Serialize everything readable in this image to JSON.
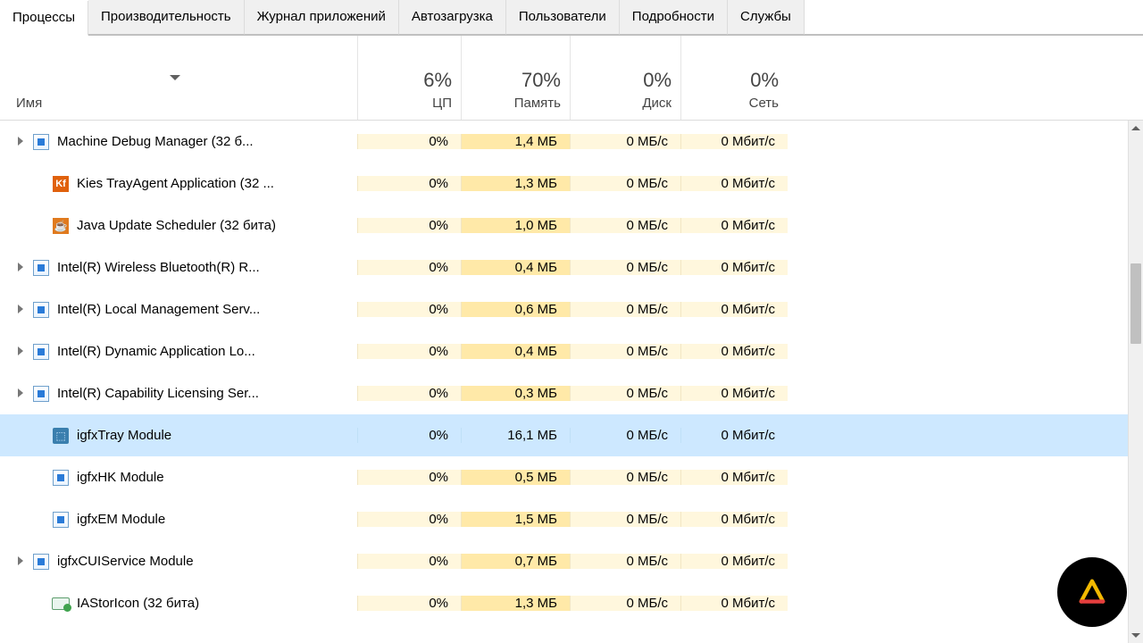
{
  "tabs": [
    "Процессы",
    "Производительность",
    "Журнал приложений",
    "Автозагрузка",
    "Пользователи",
    "Подробности",
    "Службы"
  ],
  "active_tab": 0,
  "columns": {
    "name": "Имя",
    "cpu": {
      "pct": "6%",
      "label": "ЦП"
    },
    "mem": {
      "pct": "70%",
      "label": "Память"
    },
    "disk": {
      "pct": "0%",
      "label": "Диск"
    },
    "net": {
      "pct": "0%",
      "label": "Сеть"
    }
  },
  "rows": [
    {
      "expandable": true,
      "icon": "app",
      "name": "Machine Debug Manager (32 б...",
      "cpu": "0%",
      "mem": "1,4 МБ",
      "disk": "0 МБ/с",
      "net": "0 Мбит/с"
    },
    {
      "expandable": false,
      "icon": "kies",
      "name": "Kies TrayAgent Application (32 ...",
      "cpu": "0%",
      "mem": "1,3 МБ",
      "disk": "0 МБ/с",
      "net": "0 Мбит/с"
    },
    {
      "expandable": false,
      "icon": "java",
      "name": "Java Update Scheduler (32 бита)",
      "cpu": "0%",
      "mem": "1,0 МБ",
      "disk": "0 МБ/с",
      "net": "0 Мбит/с"
    },
    {
      "expandable": true,
      "icon": "app",
      "name": "Intel(R) Wireless Bluetooth(R) R...",
      "cpu": "0%",
      "mem": "0,4 МБ",
      "disk": "0 МБ/с",
      "net": "0 Мбит/с"
    },
    {
      "expandable": true,
      "icon": "app",
      "name": "Intel(R) Local Management Serv...",
      "cpu": "0%",
      "mem": "0,6 МБ",
      "disk": "0 МБ/с",
      "net": "0 Мбит/с"
    },
    {
      "expandable": true,
      "icon": "app",
      "name": "Intel(R) Dynamic Application Lo...",
      "cpu": "0%",
      "mem": "0,4 МБ",
      "disk": "0 МБ/с",
      "net": "0 Мбит/с"
    },
    {
      "expandable": true,
      "icon": "app",
      "name": "Intel(R) Capability Licensing Ser...",
      "cpu": "0%",
      "mem": "0,3 МБ",
      "disk": "0 МБ/с",
      "net": "0 Мбит/с"
    },
    {
      "expandable": false,
      "icon": "igfx",
      "name": "igfxTray Module",
      "cpu": "0%",
      "mem": "16,1 МБ",
      "disk": "0 МБ/с",
      "net": "0 Мбит/с",
      "selected": true
    },
    {
      "expandable": false,
      "icon": "app",
      "name": "igfxHK Module",
      "cpu": "0%",
      "mem": "0,5 МБ",
      "disk": "0 МБ/с",
      "net": "0 Мбит/с"
    },
    {
      "expandable": false,
      "icon": "app",
      "name": "igfxEM Module",
      "cpu": "0%",
      "mem": "1,5 МБ",
      "disk": "0 МБ/с",
      "net": "0 Мбит/с"
    },
    {
      "expandable": true,
      "icon": "app",
      "name": "igfxCUIService Module",
      "cpu": "0%",
      "mem": "0,7 МБ",
      "disk": "0 МБ/с",
      "net": "0 Мбит/с"
    },
    {
      "expandable": false,
      "icon": "stor",
      "name": "IAStorIcon (32 бита)",
      "cpu": "0%",
      "mem": "1,3 МБ",
      "disk": "0 МБ/с",
      "net": "0 Мбит/с"
    }
  ],
  "kies_letter": "Kf"
}
